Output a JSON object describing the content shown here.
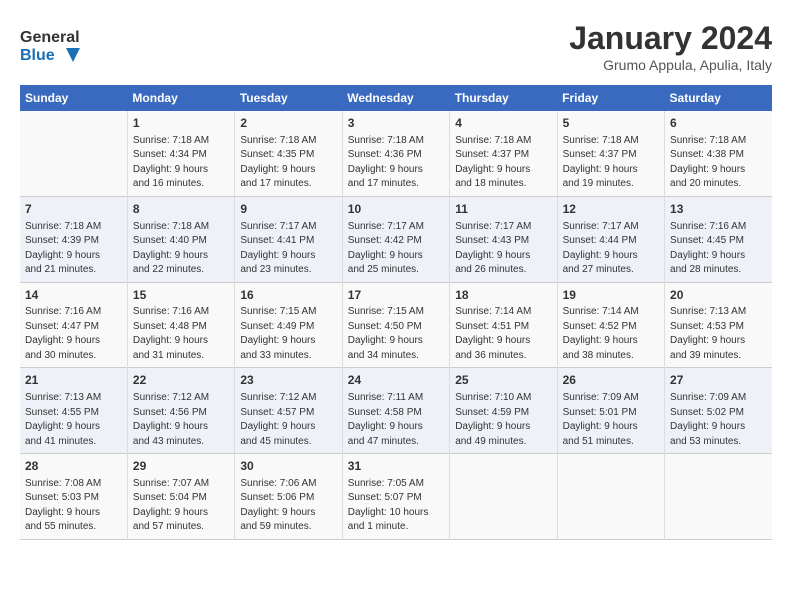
{
  "header": {
    "logo_line1": "General",
    "logo_line2": "Blue",
    "title": "January 2024",
    "subtitle": "Grumo Appula, Apulia, Italy"
  },
  "days_of_week": [
    "Sunday",
    "Monday",
    "Tuesday",
    "Wednesday",
    "Thursday",
    "Friday",
    "Saturday"
  ],
  "weeks": [
    [
      {
        "day": "",
        "info": ""
      },
      {
        "day": "1",
        "info": "Sunrise: 7:18 AM\nSunset: 4:34 PM\nDaylight: 9 hours\nand 16 minutes."
      },
      {
        "day": "2",
        "info": "Sunrise: 7:18 AM\nSunset: 4:35 PM\nDaylight: 9 hours\nand 17 minutes."
      },
      {
        "day": "3",
        "info": "Sunrise: 7:18 AM\nSunset: 4:36 PM\nDaylight: 9 hours\nand 17 minutes."
      },
      {
        "day": "4",
        "info": "Sunrise: 7:18 AM\nSunset: 4:37 PM\nDaylight: 9 hours\nand 18 minutes."
      },
      {
        "day": "5",
        "info": "Sunrise: 7:18 AM\nSunset: 4:37 PM\nDaylight: 9 hours\nand 19 minutes."
      },
      {
        "day": "6",
        "info": "Sunrise: 7:18 AM\nSunset: 4:38 PM\nDaylight: 9 hours\nand 20 minutes."
      }
    ],
    [
      {
        "day": "7",
        "info": "Sunrise: 7:18 AM\nSunset: 4:39 PM\nDaylight: 9 hours\nand 21 minutes."
      },
      {
        "day": "8",
        "info": "Sunrise: 7:18 AM\nSunset: 4:40 PM\nDaylight: 9 hours\nand 22 minutes."
      },
      {
        "day": "9",
        "info": "Sunrise: 7:17 AM\nSunset: 4:41 PM\nDaylight: 9 hours\nand 23 minutes."
      },
      {
        "day": "10",
        "info": "Sunrise: 7:17 AM\nSunset: 4:42 PM\nDaylight: 9 hours\nand 25 minutes."
      },
      {
        "day": "11",
        "info": "Sunrise: 7:17 AM\nSunset: 4:43 PM\nDaylight: 9 hours\nand 26 minutes."
      },
      {
        "day": "12",
        "info": "Sunrise: 7:17 AM\nSunset: 4:44 PM\nDaylight: 9 hours\nand 27 minutes."
      },
      {
        "day": "13",
        "info": "Sunrise: 7:16 AM\nSunset: 4:45 PM\nDaylight: 9 hours\nand 28 minutes."
      }
    ],
    [
      {
        "day": "14",
        "info": "Sunrise: 7:16 AM\nSunset: 4:47 PM\nDaylight: 9 hours\nand 30 minutes."
      },
      {
        "day": "15",
        "info": "Sunrise: 7:16 AM\nSunset: 4:48 PM\nDaylight: 9 hours\nand 31 minutes."
      },
      {
        "day": "16",
        "info": "Sunrise: 7:15 AM\nSunset: 4:49 PM\nDaylight: 9 hours\nand 33 minutes."
      },
      {
        "day": "17",
        "info": "Sunrise: 7:15 AM\nSunset: 4:50 PM\nDaylight: 9 hours\nand 34 minutes."
      },
      {
        "day": "18",
        "info": "Sunrise: 7:14 AM\nSunset: 4:51 PM\nDaylight: 9 hours\nand 36 minutes."
      },
      {
        "day": "19",
        "info": "Sunrise: 7:14 AM\nSunset: 4:52 PM\nDaylight: 9 hours\nand 38 minutes."
      },
      {
        "day": "20",
        "info": "Sunrise: 7:13 AM\nSunset: 4:53 PM\nDaylight: 9 hours\nand 39 minutes."
      }
    ],
    [
      {
        "day": "21",
        "info": "Sunrise: 7:13 AM\nSunset: 4:55 PM\nDaylight: 9 hours\nand 41 minutes."
      },
      {
        "day": "22",
        "info": "Sunrise: 7:12 AM\nSunset: 4:56 PM\nDaylight: 9 hours\nand 43 minutes."
      },
      {
        "day": "23",
        "info": "Sunrise: 7:12 AM\nSunset: 4:57 PM\nDaylight: 9 hours\nand 45 minutes."
      },
      {
        "day": "24",
        "info": "Sunrise: 7:11 AM\nSunset: 4:58 PM\nDaylight: 9 hours\nand 47 minutes."
      },
      {
        "day": "25",
        "info": "Sunrise: 7:10 AM\nSunset: 4:59 PM\nDaylight: 9 hours\nand 49 minutes."
      },
      {
        "day": "26",
        "info": "Sunrise: 7:09 AM\nSunset: 5:01 PM\nDaylight: 9 hours\nand 51 minutes."
      },
      {
        "day": "27",
        "info": "Sunrise: 7:09 AM\nSunset: 5:02 PM\nDaylight: 9 hours\nand 53 minutes."
      }
    ],
    [
      {
        "day": "28",
        "info": "Sunrise: 7:08 AM\nSunset: 5:03 PM\nDaylight: 9 hours\nand 55 minutes."
      },
      {
        "day": "29",
        "info": "Sunrise: 7:07 AM\nSunset: 5:04 PM\nDaylight: 9 hours\nand 57 minutes."
      },
      {
        "day": "30",
        "info": "Sunrise: 7:06 AM\nSunset: 5:06 PM\nDaylight: 9 hours\nand 59 minutes."
      },
      {
        "day": "31",
        "info": "Sunrise: 7:05 AM\nSunset: 5:07 PM\nDaylight: 10 hours\nand 1 minute."
      },
      {
        "day": "",
        "info": ""
      },
      {
        "day": "",
        "info": ""
      },
      {
        "day": "",
        "info": ""
      }
    ]
  ]
}
